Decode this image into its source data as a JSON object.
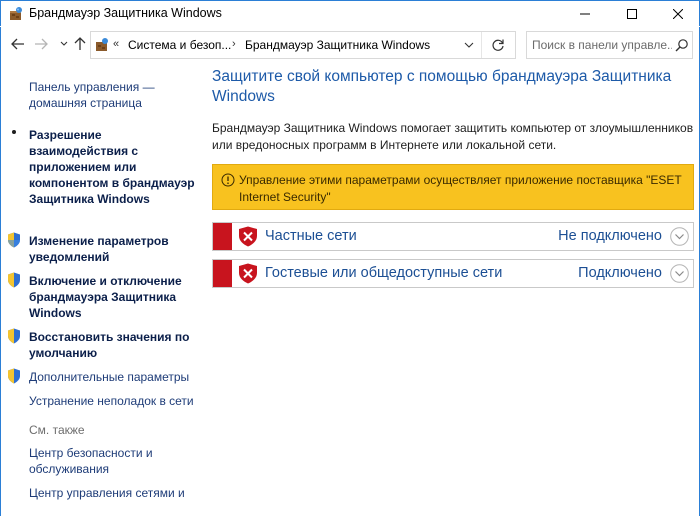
{
  "window": {
    "title": "Брандмауэр Защитника Windows"
  },
  "address": {
    "overflow": "«",
    "crumbs": [
      "Система и безоп...",
      "Брандмауэр Защитника Windows"
    ],
    "separator": "›"
  },
  "search": {
    "placeholder": "Поиск в панели управле..."
  },
  "sidebar": {
    "home_link": "Панель управления — домашняя страница",
    "items": [
      {
        "label": "Разрешение взаимодействия с приложением или компонентом в брандмауэр Защитника Windows",
        "icon": "bullet"
      },
      {
        "label": "Изменение параметров уведомлений",
        "icon": "uac-shield-icon"
      },
      {
        "label": "Включение и отключение брандмауэра Защитника Windows",
        "icon": "uac-shield-icon"
      },
      {
        "label": "Восстановить значения по умолчанию",
        "icon": "uac-shield-icon"
      },
      {
        "label": "Дополнительные параметры",
        "icon": "uac-shield-icon"
      },
      {
        "label": "Устранение неполадок в сети",
        "icon": "none"
      }
    ],
    "see_also_heading": "См. также",
    "see_also": [
      "Центр безопасности и обслуживания",
      "Центр управления сетями и"
    ]
  },
  "main": {
    "title": "Защитите свой компьютер с помощью брандмауэра Защитника Windows",
    "description": "Брандмауэр Защитника Windows помогает защитить компьютер от злоумышленников или вредоносных программ в Интернете или локальной сети.",
    "warning": "Управление этими параметрами осуществляет приложение поставщика \"ESET Internet Security\"",
    "networks": [
      {
        "name": "Частные сети",
        "status": "Не подключено"
      },
      {
        "name": "Гостевые или общедоступные сети",
        "status": "Подключено"
      }
    ]
  },
  "colors": {
    "accent": "#1d5aa8",
    "warning": "#f8c21f",
    "danger": "#c8141e"
  }
}
